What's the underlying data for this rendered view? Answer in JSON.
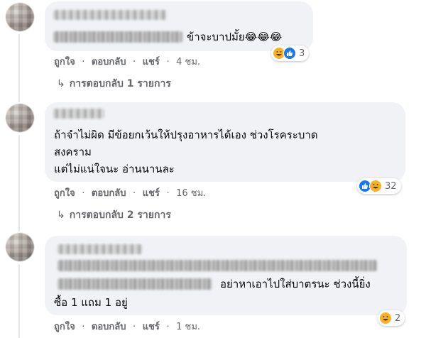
{
  "comments": [
    {
      "text_lines": [
        "ข้าจะบาปมั้ย😂😂😂"
      ],
      "actions": {
        "like": "ถูกใจ",
        "reply": "ตอบกลับ",
        "share": "แชร์",
        "time": "4 ชม."
      },
      "reaction_count": "3",
      "reaction_icons": [
        "haha-icon",
        "like-icon"
      ],
      "replies_label": "การตอบกลับ 1 รายการ"
    },
    {
      "text_lines": [
        "ถ้าจำไม่ผิด มีข้อยกเว้นให้ปรุงอาหารได้เอง ช่วงโรคระบาด",
        "สงคราม",
        "แต่ไม่แน่ใจนะ อ่านนานละ"
      ],
      "actions": {
        "like": "ถูกใจ",
        "reply": "ตอบกลับ",
        "share": "แชร์",
        "time": "16 ชม."
      },
      "reaction_count": "32",
      "reaction_icons": [
        "like-icon",
        "haha-icon"
      ],
      "replies_label": "การตอบกลับ 2 รายการ"
    },
    {
      "text_lines": [
        "อย่าหาเอาไปใส่บาตรนะ ช่วงนี้ยิ่ง",
        "ซื้อ 1 แถม 1 อยู่"
      ],
      "actions": {
        "like": "ถูกใจ",
        "reply": "ตอบกลับ",
        "share": "แชร์",
        "time": "1 ชม."
      },
      "reaction_count": "2",
      "reaction_icons": [
        "haha-icon"
      ]
    }
  ],
  "separator": "·",
  "colors": {
    "bubble": "#f0f2f5",
    "meta": "#65676b",
    "like_blue": "#1877f2",
    "haha_yellow": "#f7b125"
  }
}
